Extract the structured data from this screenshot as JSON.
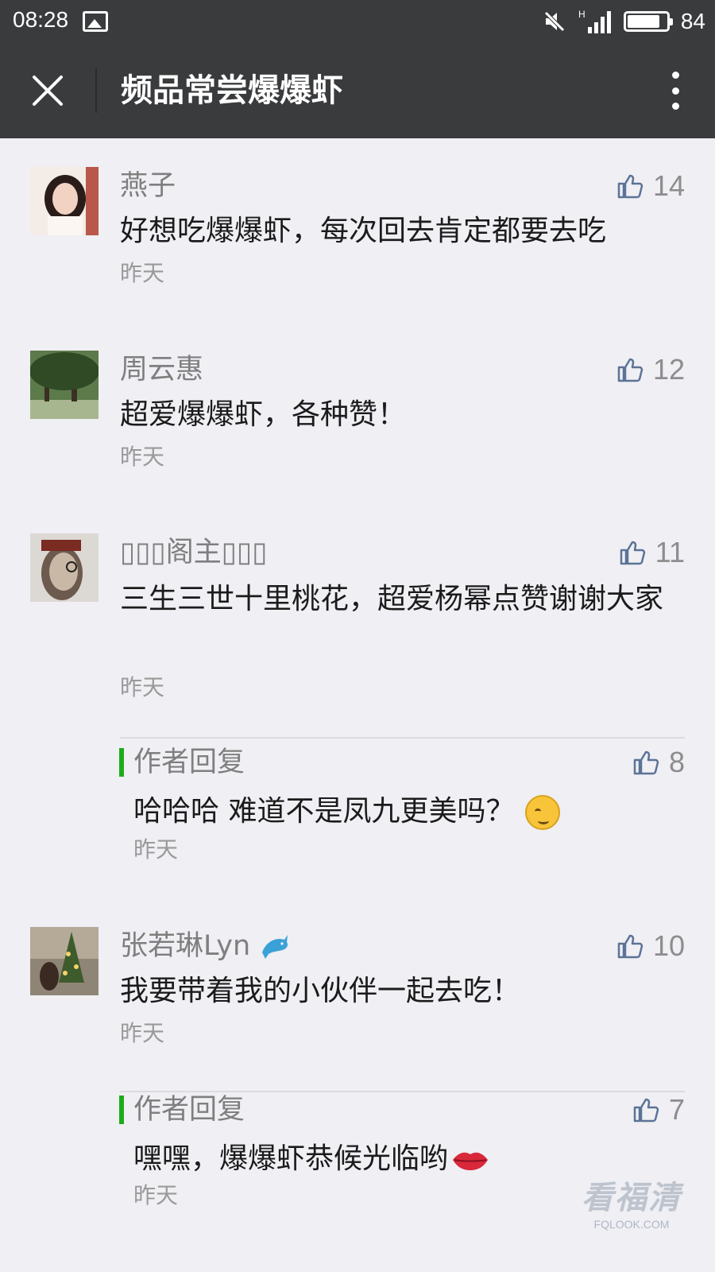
{
  "status_bar": {
    "time": "08:28",
    "battery": "84",
    "battery_level": 0.84,
    "network": "H",
    "icons": [
      "image-icon",
      "mute-icon",
      "signal-icon",
      "battery-icon"
    ]
  },
  "nav": {
    "title": "频品常尝爆爆虾",
    "icons": [
      "close-icon",
      "more-icon"
    ]
  },
  "comments": [
    {
      "name": "燕子",
      "text": "好想吃爆爆虾，每次回去肯定都要去吃",
      "time": "昨天",
      "likes": "14"
    },
    {
      "name": "周云惠",
      "text": "超爱爆爆虾，各种赞！",
      "time": "昨天",
      "likes": "12"
    },
    {
      "name": "▯▯▯阁主▯▯▯",
      "text": "三生三世十里桃花，超爱杨幂点赞谢谢大家",
      "time": "昨天",
      "likes": "11",
      "reply": {
        "label": "作者回复",
        "text": "哈哈哈 难道不是凤九更美吗？",
        "time": "昨天",
        "likes": "8",
        "emoji": "grin-emoji"
      }
    },
    {
      "name": "张若琳Lyn",
      "name_emoji": "dolphin-emoji",
      "text": "我要带着我的小伙伴一起去吃！",
      "time": "昨天",
      "likes": "10",
      "reply": {
        "label": "作者回复",
        "text": "嘿嘿，爆爆虾恭候光临哟",
        "time": "昨天",
        "likes": "7",
        "emoji": "lips-emoji"
      }
    }
  ],
  "colors": {
    "nav_bg": "#3a3b3d",
    "page_bg": "#efeff4",
    "reply_accent": "#1aad19",
    "like_icon": "#5b7396"
  },
  "watermark": {
    "main": "看福清",
    "sub": "FQLOOK.COM"
  }
}
